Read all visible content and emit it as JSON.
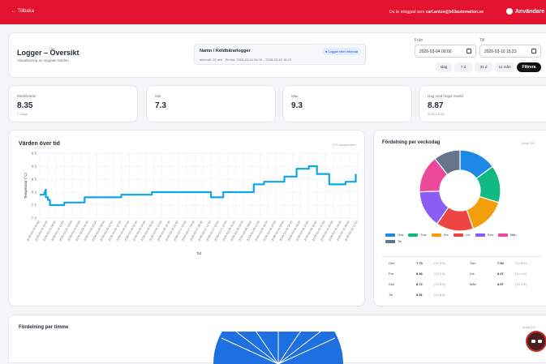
{
  "topbar": {
    "back_label": "← Tillbaka",
    "logged_prefix": "Du är inloggad som",
    "logged_user": "carl.anton@b03automation.se",
    "user_label": "Användare"
  },
  "header": {
    "title": "Logger – Översikt",
    "subtitle": "Visualisering av loggade värden",
    "logger_name": "Namn / Köldbärarlogger",
    "interval_text": "Intervall: 20 min",
    "period_text": "Period: 2026-03-04 00:00 – 2026-03-10 15:20",
    "pill_label": "Loggar efter intervall",
    "from_label": "Från",
    "from_value": "2026-03-04 00:00",
    "to_label": "Till",
    "to_value": "2026-03-10 15:23",
    "quick": [
      "Idag",
      "7 d",
      "31 d",
      "12 mån"
    ],
    "filter_label": "Filtrera"
  },
  "stats": [
    {
      "label": "Medelvärde",
      "value": "8.35",
      "sub": "7 dagar"
    },
    {
      "label": "Min",
      "value": "7.3",
      "sub": ""
    },
    {
      "label": "Max",
      "value": "9.3",
      "sub": ""
    },
    {
      "label": "Dag med högst medel",
      "value": "8.87",
      "sub": "2026-03-08"
    }
  ],
  "chart": {
    "title": "Värden över tid",
    "count": "475 datapunkter",
    "ylabel": "Temperatur (°C)",
    "xlabel": "Tid"
  },
  "chart_data": {
    "type": "line",
    "title": "Värden över tid",
    "xlabel": "Tid",
    "ylabel": "Temperatur (°C)",
    "ylim": [
      7.0,
      9.5
    ],
    "yticks": [
      7.0,
      7.5,
      8.0,
      8.5,
      9.0,
      9.5
    ],
    "grid": true,
    "color": "#0ea5e9",
    "x_ticks": [
      "2026-03-04 00:00",
      "2026-03-04 04:00",
      "2026-03-04 08:00",
      "2026-03-04 12:00",
      "2026-03-04 16:00",
      "2026-03-04 20:00",
      "2026-03-05 00:00",
      "2026-03-05 04:00",
      "2026-03-05 08:00",
      "2026-03-05 12:00",
      "2026-03-05 16:00",
      "2026-03-05 20:00",
      "2026-03-06 00:00",
      "2026-03-06 04:00",
      "2026-03-06 08:00",
      "2026-03-06 12:00",
      "2026-03-06 16:00",
      "2026-03-06 20:00",
      "2026-03-07 00:00",
      "2026-03-07 04:00",
      "2026-03-07 08:00",
      "2026-03-07 12:00",
      "2026-03-07 16:00",
      "2026-03-07 20:00",
      "2026-03-08 00:00",
      "2026-03-08 04:00",
      "2026-03-08 08:00",
      "2026-03-08 12:00",
      "2026-03-08 16:00",
      "2026-03-08 20:00",
      "2026-03-09 00:00",
      "2026-03-09 04:00",
      "2026-03-09 08:00",
      "2026-03-09 12:00",
      "2026-03-09 16:00",
      "2026-03-09 20:00",
      "2026-03-10 00:00",
      "2026-03-10 04:00",
      "2026-03-10 08:00",
      "2026-03-10 12:00"
    ],
    "series": [
      {
        "x": [
          0,
          2,
          3,
          3,
          4,
          4,
          5,
          5,
          12,
          12,
          22,
          22,
          40,
          40,
          55,
          55,
          70,
          70,
          84,
          84,
          90,
          90,
          105,
          105,
          110,
          110,
          120,
          120,
          126,
          126,
          132,
          132,
          136,
          136,
          142,
          142,
          150,
          150,
          155,
          155
        ],
        "y": [
          7.9,
          7.9,
          8.1,
          7.8,
          7.8,
          7.7,
          7.7,
          7.5,
          7.5,
          7.6,
          7.6,
          7.8,
          7.8,
          7.9,
          7.9,
          8.0,
          8.0,
          8.0,
          8.0,
          7.8,
          7.8,
          8.0,
          8.0,
          8.3,
          8.3,
          8.4,
          8.4,
          8.6,
          8.6,
          8.9,
          8.9,
          9.0,
          9.0,
          8.7,
          8.7,
          8.3,
          8.3,
          8.4,
          8.4,
          8.7
        ]
      }
    ]
  },
  "week": {
    "title": "Fördelning per veckodag",
    "unit": "Antal (%)",
    "colors": [
      "#1e88e5",
      "#10b981",
      "#f59e0b",
      "#ef4444",
      "#8b5cf6",
      "#ec4899",
      "#64748b"
    ],
    "legend": [
      "Ons",
      "Tors",
      "Fre",
      "Lör",
      "Sön",
      "Mån",
      "Tis"
    ],
    "slices": [
      14.9,
      14.9,
      14.9,
      14.9,
      14.9,
      14.9,
      10.6
    ],
    "table": [
      {
        "day": "Ons",
        "value": "7.73",
        "pct": "(14.9%)"
      },
      {
        "day": "Tors",
        "value": "7.94",
        "pct": "(13.6%)"
      },
      {
        "day": "Fre",
        "value": "8.36",
        "pct": "(14.1%)"
      },
      {
        "day": "Lör",
        "value": "8.47",
        "pct": "(14.1%)"
      },
      {
        "day": "Sön",
        "value": "8.72",
        "pct": "(14.9%)"
      },
      {
        "day": "Mån",
        "value": "8.57",
        "pct": "(15.2%)"
      },
      {
        "day": "Tis",
        "value": "8.51",
        "pct": "(14.6%)"
      }
    ]
  },
  "hour": {
    "title": "Fördelning per timme",
    "unit": "Antal (%)"
  }
}
